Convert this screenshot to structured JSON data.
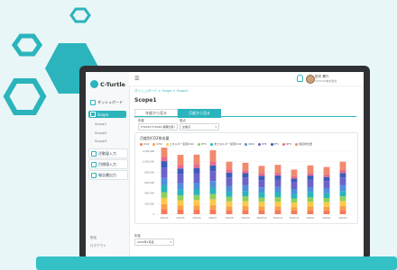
{
  "app": {
    "brand_name": "C-Turtle",
    "user_name": "田中 健介",
    "user_org": "XXXXXX株式会社"
  },
  "sidebar": {
    "dashboard_label": "ダッシュボード",
    "scope_label": "Scope",
    "sub_items": [
      "Scope1",
      "Scope2",
      "Scope3"
    ],
    "groups": [
      "活動量入力",
      "目標値入力",
      "報告書出力"
    ],
    "footer_items": [
      "設定",
      "ログアウト"
    ]
  },
  "main": {
    "breadcrumb": "ダッシュボード > Scope > Scope1",
    "page_title": "Scope1",
    "tabs": [
      {
        "label": "年度から見る",
        "active": false
      },
      {
        "label": "月度から見る",
        "active": true
      }
    ],
    "filters": [
      {
        "label": "年度",
        "value": "FY2023 FY2024 前期比較"
      },
      {
        "label": "拠点",
        "value": "全拠点"
      }
    ],
    "bottom_label": "年度",
    "bottom_select": "2024年1月度"
  },
  "chart_data": {
    "type": "bar",
    "title": "月度別CO2排出量",
    "stacked": true,
    "categories": [
      "2023/4",
      "2023/5",
      "2023/6",
      "2023/7",
      "2023/8",
      "2023/9",
      "2023/10",
      "2023/11",
      "2023/12",
      "2024/1",
      "2024/2",
      "2024/3"
    ],
    "ylim": [
      0,
      1200000
    ],
    "yticks": [
      0,
      200000,
      400000,
      600000,
      800000,
      1000000,
      1200000
    ],
    "ytick_labels": [
      "0",
      "200,000",
      "400,000",
      "600,000",
      "800,000",
      "1,000,000",
      "1,200,000"
    ],
    "series": [
      {
        "name": "CO2",
        "color": "#f47b5a",
        "values": [
          100000,
          85000,
          85000,
          90000,
          75000,
          80000,
          75000,
          80000,
          70000,
          75000,
          72000,
          80000
        ]
      },
      {
        "name": "CH4",
        "color": "#f7a04a",
        "values": [
          90000,
          80000,
          80000,
          85000,
          75000,
          75000,
          70000,
          70000,
          65000,
          70000,
          68000,
          75000
        ]
      },
      {
        "name": "エネルギー起源CO2",
        "color": "#f9c94a",
        "values": [
          120000,
          100000,
          105000,
          110000,
          95000,
          95000,
          90000,
          90000,
          85000,
          90000,
          88000,
          95000
        ]
      },
      {
        "name": "HFC",
        "color": "#8fcf5c",
        "values": [
          110000,
          95000,
          95000,
          100000,
          85000,
          90000,
          80000,
          85000,
          75000,
          85000,
          80000,
          90000
        ]
      },
      {
        "name": "非エネルギー起源CO2",
        "color": "#2bb4bc",
        "values": [
          130000,
          110000,
          115000,
          120000,
          100000,
          100000,
          95000,
          95000,
          90000,
          95000,
          92000,
          100000
        ]
      },
      {
        "name": "N2O",
        "color": "#4f8fd9",
        "values": [
          140000,
          120000,
          120000,
          125000,
          110000,
          110000,
          100000,
          100000,
          95000,
          100000,
          98000,
          110000
        ]
      },
      {
        "name": "SF6",
        "color": "#6c63c7",
        "values": [
          200000,
          180000,
          180000,
          190000,
          160000,
          150000,
          140000,
          140000,
          130000,
          140000,
          135000,
          150000
        ]
      },
      {
        "name": "PFC",
        "color": "#3c5bb8",
        "values": [
          120000,
          100000,
          100000,
          110000,
          90000,
          80000,
          80000,
          80000,
          70000,
          80000,
          75000,
          85000
        ]
      },
      {
        "name": "NF3",
        "color": "#e86a8a",
        "values": [
          80000,
          70000,
          70000,
          75000,
          60000,
          55000,
          50000,
          50000,
          45000,
          50000,
          48000,
          55000
        ]
      },
      {
        "name": "間接排出量",
        "color": "#f08a6e",
        "values": [
          200000,
          190000,
          185000,
          215000,
          150000,
          145000,
          140000,
          150000,
          125000,
          145000,
          144000,
          160000
        ]
      }
    ]
  }
}
